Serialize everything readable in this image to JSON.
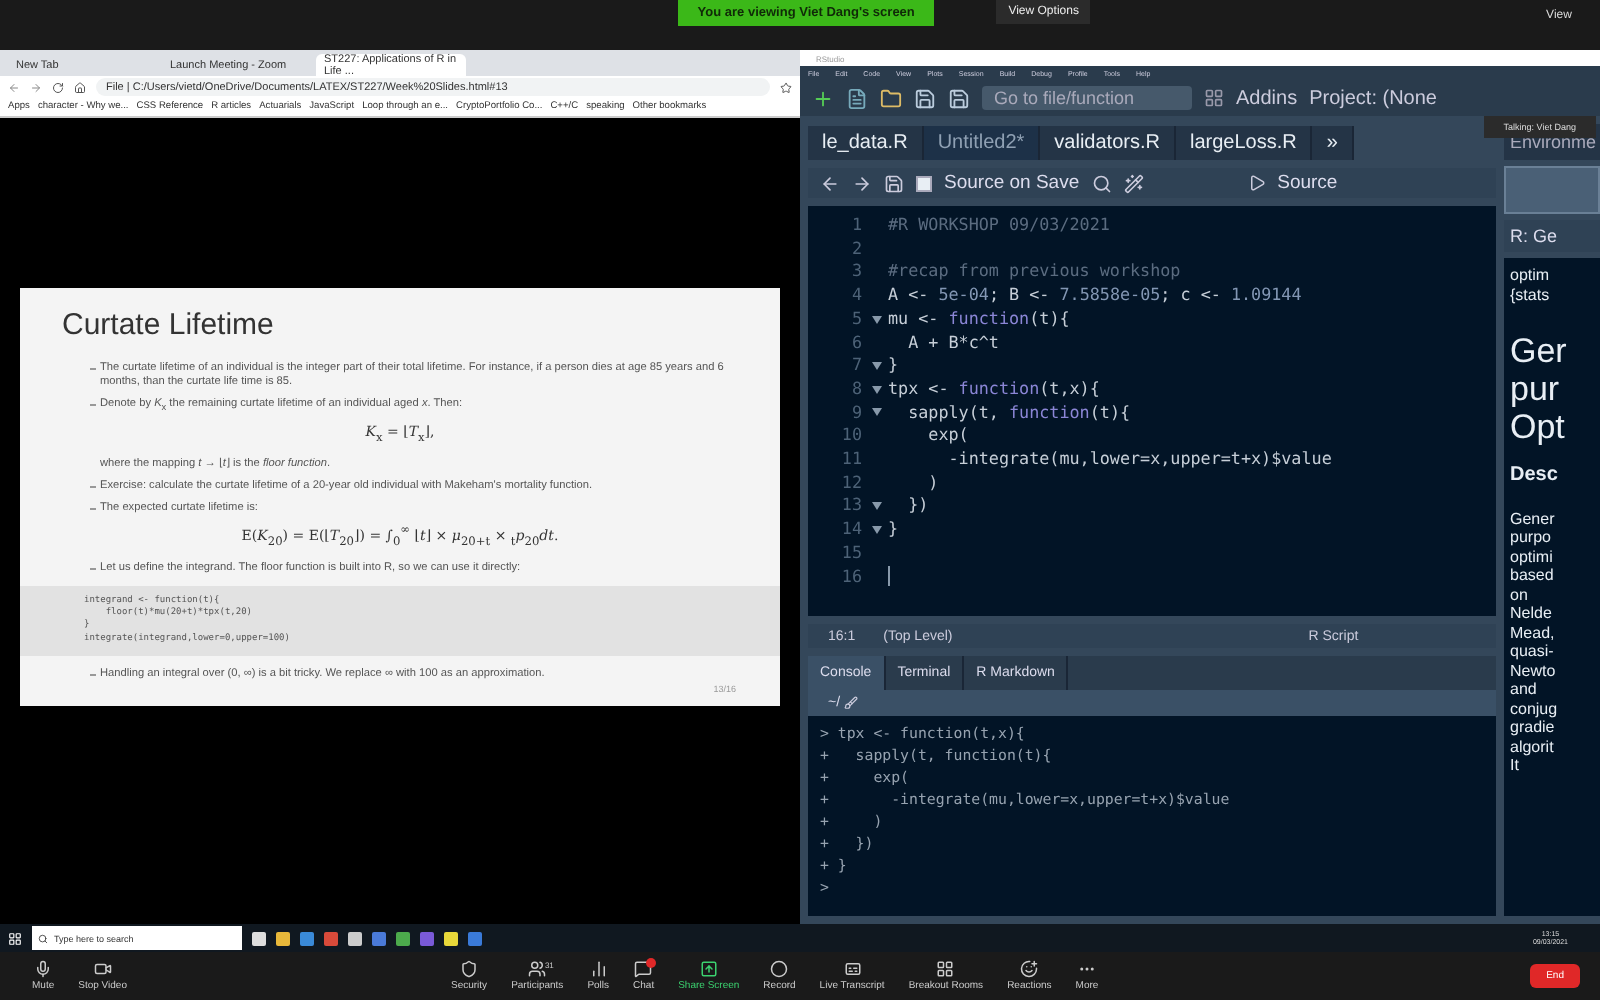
{
  "meeting_bar": {
    "banner": "You are viewing Viet Dang's screen",
    "view_options": "View Options",
    "view": "View"
  },
  "browser": {
    "tabs": [
      {
        "label": "New Tab",
        "selected": false
      },
      {
        "label": "Launch Meeting - Zoom",
        "selected": false
      },
      {
        "label": "ST227: Applications of R in Life ...",
        "selected": true
      }
    ],
    "address": "File  |  C:/Users/vietd/OneDrive/Documents/LATEX/ST227/Week%20Slides.html#13",
    "bookmarks": [
      "Apps",
      "character - Why we...",
      "CSS Reference",
      "R articles",
      "Actuarials",
      "JavaScript",
      "Loop through an e...",
      "CryptoPortfolio Co...",
      "C++/C",
      "speaking",
      "Other bookmarks"
    ]
  },
  "slide": {
    "title": "Curtate Lifetime",
    "page": "13/16",
    "items": [
      {
        "kind": "bullet",
        "text": "The curtate lifetime of an individual is the integer part of their total lifetime. For instance, if a person dies at age 85 years and 6 months, than the curtate life time is 85."
      },
      {
        "kind": "bullet",
        "text": "Denote by *K*$_{x}$ the remaining curtate lifetime of an individual aged *x*. Then:"
      },
      {
        "kind": "formula",
        "text": "*K*$_{x}$ = ⌊*T*$_{x}$⌋,"
      },
      {
        "kind": "note",
        "text": "where the mapping *t* → ⌊*t*⌋ is the *floor function*."
      },
      {
        "kind": "bullet",
        "text": "Exercise: calculate the curtate lifetime of a 20-year old individual with Makeham's mortality function."
      },
      {
        "kind": "bullet",
        "text": "The expected curtate lifetime is:"
      },
      {
        "kind": "formula",
        "text": "E(*K*$_{20}$) = E(⌊*T*$_{20}$⌋) = ∫$_{0}$$^{∞}$ ⌊*t*⌋ × *μ*$_{20+t}$ × $_{t}$*p*$_{20}$*dt*."
      },
      {
        "kind": "bullet",
        "text": "Let us define the integrand. The floor function is built into R, so we can use it directly:"
      },
      {
        "kind": "code",
        "lines": [
          "integrand <- function(t){",
          "    floor(t)*mu(20+t)*tpx(t,20)",
          "}",
          "integrate(integrand,lower=0,upper=100)"
        ]
      },
      {
        "kind": "bullet",
        "text": "Handling an integral over (0, ∞) is a bit tricky. We replace ∞ with 100 as an approximation."
      }
    ]
  },
  "rstudio": {
    "title": "RStudio",
    "menu": [
      "File",
      "Edit",
      "Code",
      "View",
      "Plots",
      "Session",
      "Build",
      "Debug",
      "Profile",
      "Tools",
      "Help"
    ],
    "goto_placeholder": "Go to file/function",
    "addins": "Addins",
    "project": "Project: (None",
    "tooltip": "Talking: Viet Dang",
    "tabs": [
      {
        "label": "le_data.R",
        "selected": false
      },
      {
        "label": "Untitled2*",
        "selected": true
      },
      {
        "label": "validators.R",
        "selected": false
      },
      {
        "label": "largeLoss.R",
        "selected": false
      }
    ],
    "more_tabs": "»",
    "source_on_save": "Source on Save",
    "source": "Source",
    "source_on_save_checked": false,
    "code": [
      {
        "number": "1",
        "fold": false,
        "tokens": [
          {
            "kind": "comment",
            "text": "#R WORKSHOP 09/03/2021"
          }
        ]
      },
      {
        "number": "2",
        "fold": false
      },
      {
        "number": "3",
        "fold": false,
        "tokens": [
          {
            "kind": "comment",
            "text": "#recap from previous workshop"
          }
        ]
      },
      {
        "number": "4",
        "fold": false,
        "tokens": [
          {
            "kind": "plain",
            "text": "A <- "
          },
          {
            "kind": "number",
            "text": "5e-04"
          },
          {
            "kind": "plain",
            "text": "; B <- "
          },
          {
            "kind": "number",
            "text": "7.5858e-05"
          },
          {
            "kind": "plain",
            "text": "; c <- "
          },
          {
            "kind": "number",
            "text": "1.09144"
          }
        ]
      },
      {
        "number": "5",
        "fold": true,
        "tokens": [
          {
            "kind": "plain",
            "text": "mu <- "
          },
          {
            "kind": "keyword",
            "text": "function"
          },
          {
            "kind": "plain",
            "text": "(t){"
          }
        ]
      },
      {
        "number": "6",
        "fold": false,
        "tokens": [
          {
            "kind": "plain",
            "text": "  A + B*c^t"
          }
        ]
      },
      {
        "number": "7",
        "fold": true,
        "tokens": [
          {
            "kind": "plain",
            "text": "}"
          }
        ]
      },
      {
        "number": "8",
        "fold": true,
        "tokens": [
          {
            "kind": "plain",
            "text": "tpx <- "
          },
          {
            "kind": "keyword",
            "text": "function"
          },
          {
            "kind": "plain",
            "text": "(t,x){"
          }
        ]
      },
      {
        "number": "9",
        "fold": true,
        "tokens": [
          {
            "kind": "plain",
            "text": "  sapply(t, "
          },
          {
            "kind": "keyword",
            "text": "function"
          },
          {
            "kind": "plain",
            "text": "(t){"
          }
        ]
      },
      {
        "number": "10",
        "fold": false,
        "tokens": [
          {
            "kind": "plain",
            "text": "    exp("
          }
        ]
      },
      {
        "number": "11",
        "fold": false,
        "tokens": [
          {
            "kind": "plain",
            "text": "      -integrate(mu,lower=x,upper=t+x)$value"
          }
        ]
      },
      {
        "number": "12",
        "fold": false,
        "tokens": [
          {
            "kind": "plain",
            "text": "    )"
          }
        ]
      },
      {
        "number": "13",
        "fold": true,
        "tokens": [
          {
            "kind": "plain",
            "text": "  })"
          }
        ]
      },
      {
        "number": "14",
        "fold": true,
        "tokens": [
          {
            "kind": "plain",
            "text": "}"
          }
        ]
      },
      {
        "number": "15",
        "fold": false
      },
      {
        "number": "16",
        "fold": false
      }
    ],
    "cursor": "16:1",
    "scope": "(Top Level)",
    "file_type": "R Script",
    "console_tabs": [
      {
        "label": "Console",
        "selected": true
      },
      {
        "label": "Terminal",
        "selected": false
      },
      {
        "label": "R Markdown",
        "selected": false
      }
    ],
    "console_path": "~/",
    "console": [
      {
        "prompt": ">",
        "text": "tpx <- function(t,x){"
      },
      {
        "prompt": "+",
        "text": "  sapply(t, function(t){"
      },
      {
        "prompt": "+",
        "text": "    exp("
      },
      {
        "prompt": "+",
        "text": "      -integrate(mu,lower=x,upper=t+x)$value"
      },
      {
        "prompt": "+",
        "text": "    )"
      },
      {
        "prompt": "+",
        "text": "  })"
      },
      {
        "prompt": "+",
        "text": "}"
      },
      {
        "prompt": ">"
      }
    ],
    "side_tab": "Environme",
    "help_topic": "R: Ge",
    "help_lines": [
      "optim",
      "{stats"
    ],
    "help_heading": [
      "Ger",
      "pur",
      "Opt"
    ],
    "help_section": "Desc",
    "help_body": [
      "Gener",
      "purpo",
      "optimi",
      "based",
      "on",
      "Nelde",
      "Mead,",
      "quasi-",
      "Newto",
      "and",
      "conjug",
      "gradie",
      "algorit",
      "It"
    ]
  },
  "taskbar": {
    "search_placeholder": "Type here to search",
    "time": "13:15",
    "date": "09/03/2021"
  },
  "zoom_toolbar": {
    "items": [
      {
        "label": "Mute"
      },
      {
        "label": "Stop Video"
      },
      {
        "label": "Security"
      },
      {
        "label": "Participants",
        "count": "31"
      },
      {
        "label": "Polls"
      },
      {
        "label": "Chat",
        "alert": true
      },
      {
        "label": "Share Screen",
        "highlight": true
      },
      {
        "label": "Record"
      },
      {
        "label": "Live Transcript"
      },
      {
        "label": "Breakout Rooms"
      },
      {
        "label": "Reactions"
      },
      {
        "label": "More"
      }
    ],
    "end": "End"
  }
}
